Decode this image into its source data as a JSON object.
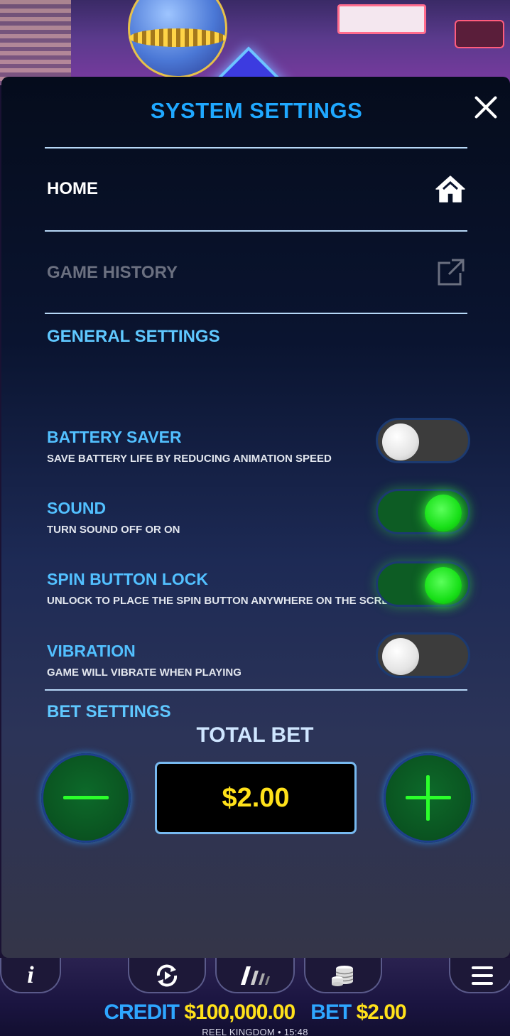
{
  "settings_panel": {
    "title": "SYSTEM SETTINGS",
    "home_label": "HOME",
    "game_history_label": "GAME HISTORY",
    "general_settings_title": "GENERAL SETTINGS",
    "items": [
      {
        "title": "BATTERY SAVER",
        "description": "SAVE BATTERY LIFE BY REDUCING ANIMATION SPEED",
        "enabled": false
      },
      {
        "title": "SOUND",
        "description": "TURN SOUND OFF OR ON",
        "enabled": true
      },
      {
        "title": "SPIN BUTTON LOCK",
        "description": "UNLOCK TO PLACE THE SPIN BUTTON ANYWHERE ON THE SCREEN",
        "enabled": true
      },
      {
        "title": "VIBRATION",
        "description": "GAME WILL VIBRATE WHEN PLAYING",
        "enabled": false
      }
    ],
    "bet_settings_title": "BET SETTINGS",
    "total_bet_label": "TOTAL BET",
    "total_bet_value": "$2.00"
  },
  "bottom_bar": {
    "info_glyph": "i",
    "credit_label": "CREDIT",
    "credit_value": "$100,000.00",
    "bet_label": "BET",
    "bet_value": "$2.00",
    "footer": "REEL KINGDOM • 15:48"
  },
  "icons": [
    "close-icon",
    "home-icon",
    "external-link-icon",
    "minus-icon",
    "plus-icon",
    "info-icon",
    "autoplay-icon",
    "turbo-icon",
    "coins-icon",
    "hamburger-menu-icon"
  ],
  "colors": {
    "title_blue": "#1fa8ff",
    "section_blue": "#5fc8ff",
    "toggle_on_green": "#18e018",
    "bet_yellow": "#ffe11a"
  }
}
